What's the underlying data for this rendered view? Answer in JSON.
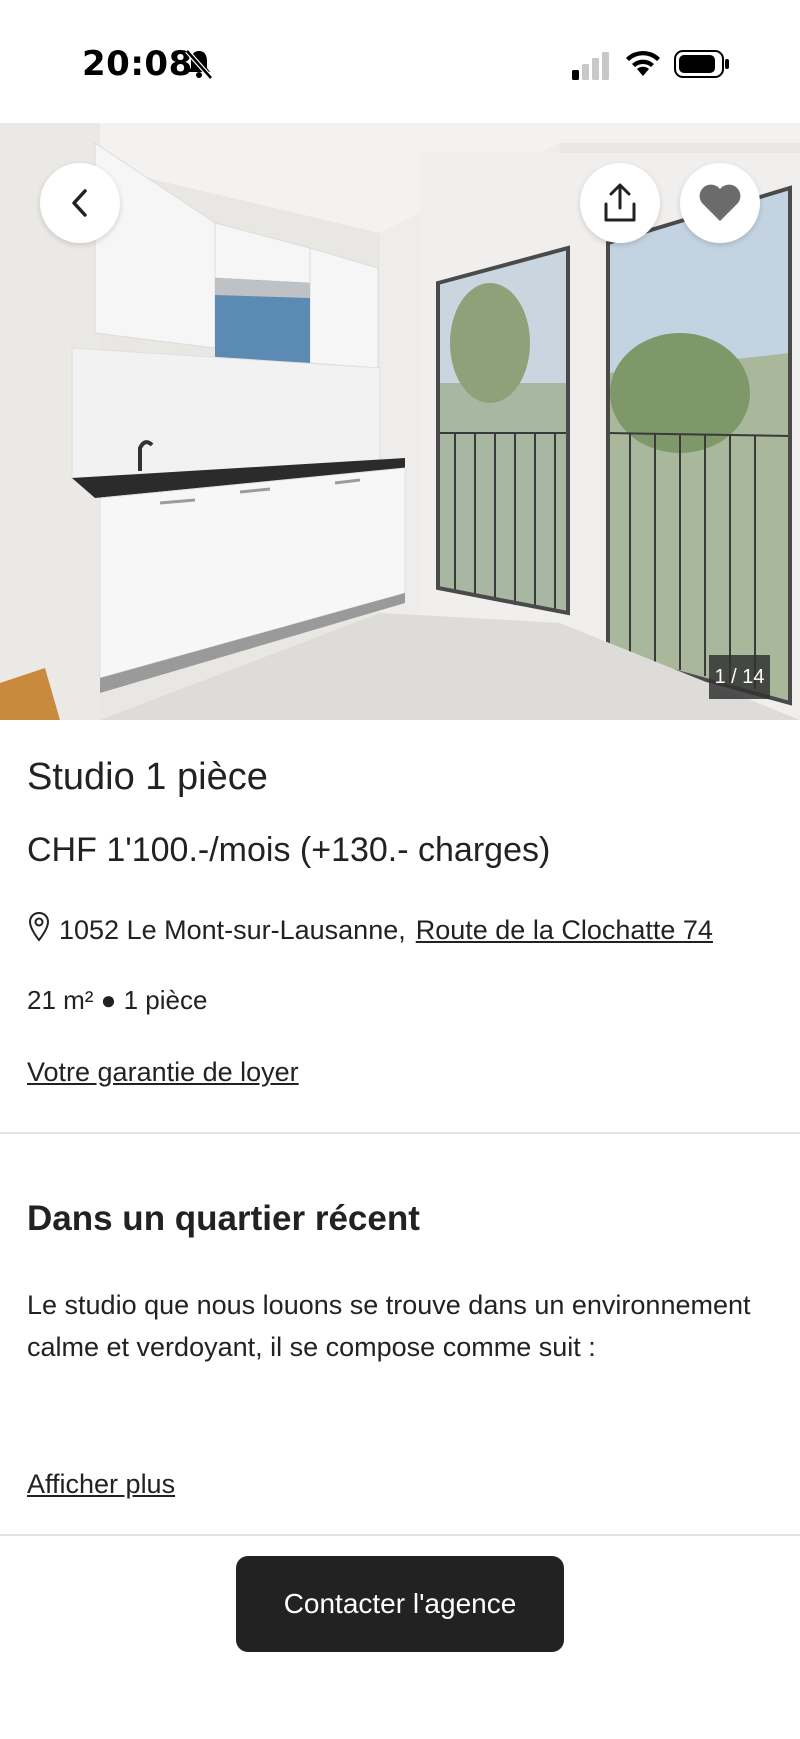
{
  "status_bar": {
    "time": "20:08",
    "icons": [
      "bell-slash-icon",
      "cellular-signal-icon",
      "wifi-icon",
      "battery-icon"
    ]
  },
  "gallery": {
    "photo_subject": "kitchenette-and-balcony-window",
    "counter": "1 / 14",
    "buttons": [
      "back-icon",
      "share-icon",
      "heart-icon"
    ]
  },
  "listing": {
    "title": "Studio 1 pièce",
    "price": "CHF 1'100.-/mois (+130.- charges)",
    "address_locality": "1052 Le Mont-sur-Lausanne,",
    "address_street": "Route de la Clochatte 74",
    "specs": "21 m² ● 1 pièce",
    "guarantee_link": "Votre garantie de loyer"
  },
  "description": {
    "title": "Dans un quartier récent",
    "text": "Le studio que nous louons se trouve dans un environnement calme et verdoyant, il se compose comme suit :",
    "more_link": "Afficher plus"
  },
  "footer": {
    "contact_button": "Contacter l'agence"
  },
  "colors": {
    "text": "#222222",
    "button_bg": "#222222",
    "button_text": "#ffffff",
    "divider": "#e2e2e2"
  }
}
